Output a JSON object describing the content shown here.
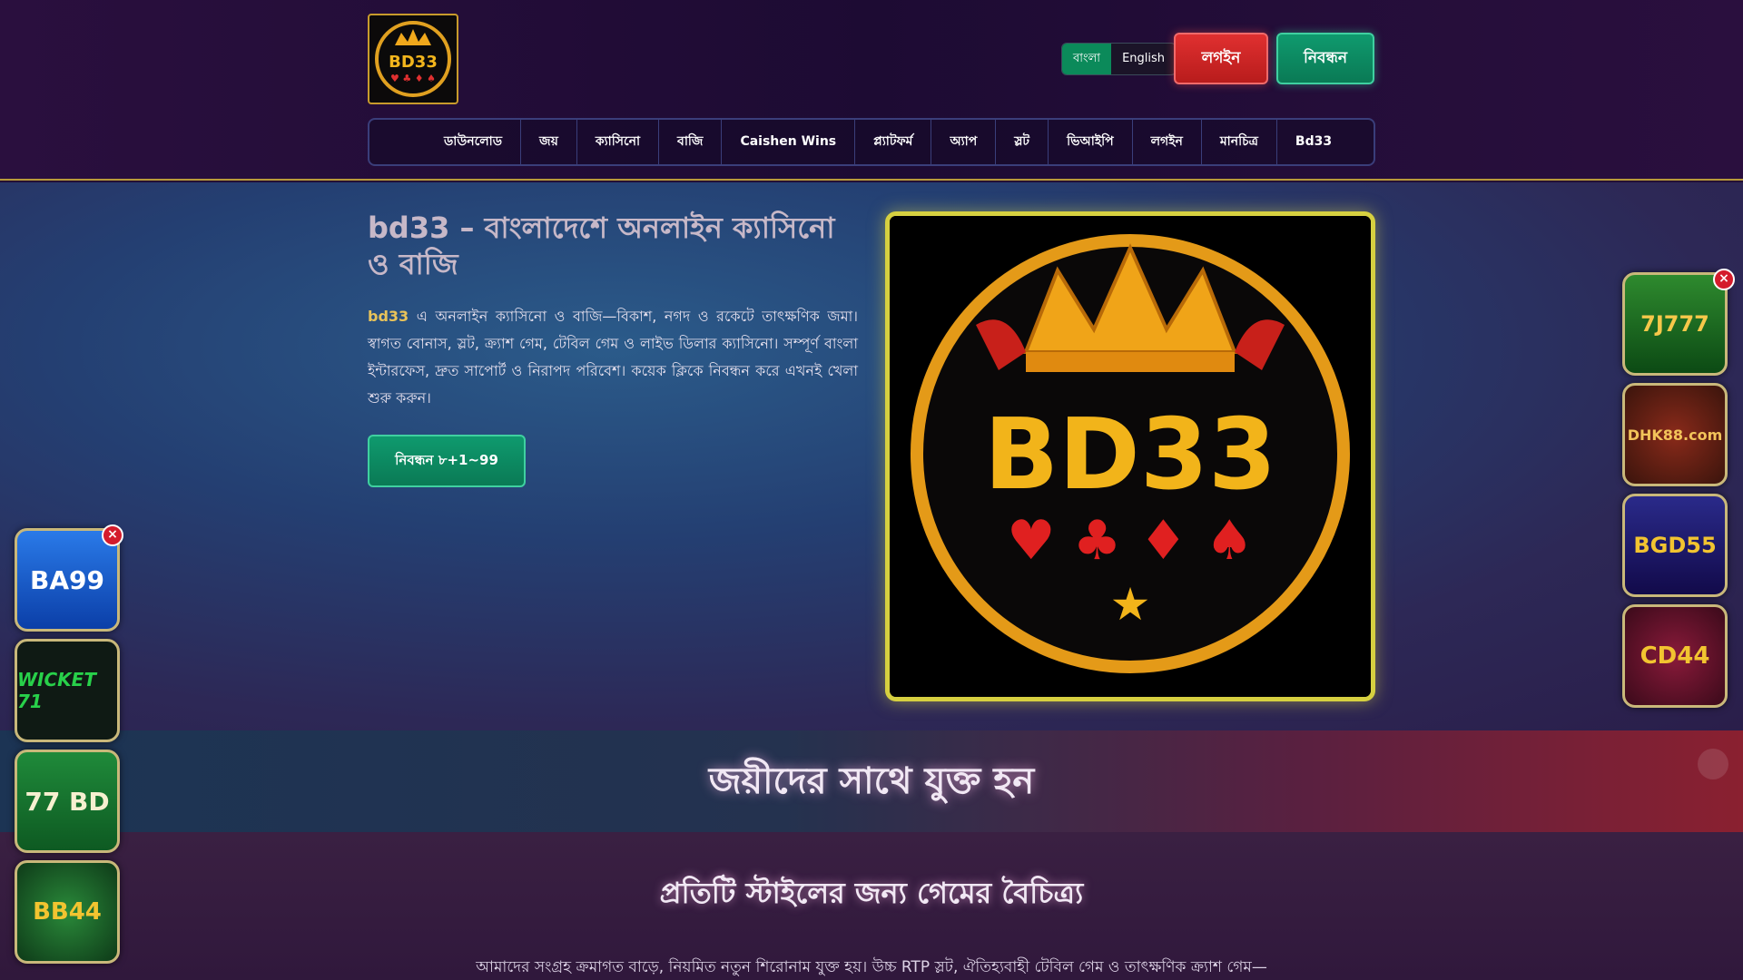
{
  "header": {
    "logo_text": "BD33",
    "lang": {
      "bn": "বাংলা",
      "en": "English"
    },
    "login_label": "লগইন",
    "register_label": "নিবন্ধন"
  },
  "nav": {
    "items": [
      "ডাউনলোড",
      "জয়",
      "ক্যাসিনো",
      "বাজি",
      "Caishen Wins",
      "প্ল্যাটফর্ম",
      "অ্যাপ",
      "স্লট",
      "ভিআইপি",
      "লগইন",
      "মানচিত্র",
      "Bd33"
    ]
  },
  "hero": {
    "title": "bd33 – বাংলাদেশে অনলাইন ক্যাসিনো ও বাজি",
    "brand": "bd33",
    "text": "এ অনলাইন ক্যাসিনো ও বাজি—বিকাশ, নগদ ও রকেটে তাৎক্ষণিক জমা। স্বাগত বোনাস, স্লট, ক্র্যাশ গেম, টেবিল গেম ও লাইভ ডিলার ক্যাসিনো। সম্পূর্ণ বাংলা ইন্টারফেস, দ্রুত সাপোর্ট ও নিরাপদ পরিবেশ। কয়েক ক্লিকে নিবন্ধন করে এখনই খেলা শুরু করুন।",
    "cta_label": "নিবন্ধন ৮+1~99",
    "image_text": "BD33"
  },
  "banner": {
    "title": "জয়ীদের সাথে যুক্ত হন"
  },
  "section": {
    "title": "প্রতিটি স্টাইলের জন্য গেমের বৈচিত্র্য",
    "text": "আমাদের সংগ্রহ ক্রমাগত বাড়ে, নিয়মিত নতুন শিরোনাম যুক্ত হয়। উচ্চ RTP স্লট, ঐতিহ্যবাহী টেবিল গেম ও তাৎক্ষণিক ক্র্যাশ গেম—"
  },
  "left_ads": {
    "close": "×",
    "items": [
      "BA99",
      "WICKET 71",
      "77 BD",
      "BB44"
    ]
  },
  "right_ads": {
    "close": "×",
    "items": [
      "7J777",
      "DHK88.com",
      "BGD55",
      "CD44"
    ]
  }
}
